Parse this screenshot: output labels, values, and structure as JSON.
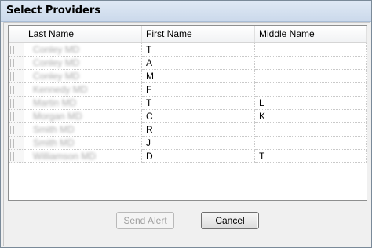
{
  "window": {
    "title": "Select Providers"
  },
  "grid": {
    "columns": [
      "Last Name",
      "First Name",
      "Middle Name"
    ],
    "rows": [
      {
        "last": "Conley MD",
        "first": "T",
        "middle": ""
      },
      {
        "last": "Conley MD",
        "first": "A",
        "middle": ""
      },
      {
        "last": "Conley MD",
        "first": "M",
        "middle": ""
      },
      {
        "last": "Kennedy MD",
        "first": "F",
        "middle": ""
      },
      {
        "last": "Martin MD",
        "first": "T",
        "middle": "L"
      },
      {
        "last": "Morgan MD",
        "first": "C",
        "middle": "K"
      },
      {
        "last": "Smith MD",
        "first": "R",
        "middle": ""
      },
      {
        "last": "Smith MD",
        "first": "J",
        "middle": ""
      },
      {
        "last": "Williamson MD",
        "first": "D",
        "middle": "T"
      }
    ]
  },
  "buttons": {
    "send_alert": "Send Alert",
    "cancel": "Cancel"
  }
}
